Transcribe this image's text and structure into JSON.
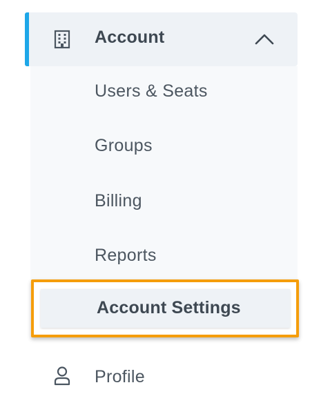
{
  "nav": {
    "account_section": {
      "label": "Account",
      "icon": "building-icon",
      "expanded": true,
      "accent_color": "#1ea7e8",
      "items": [
        {
          "label": "Users & Seats"
        },
        {
          "label": "Groups"
        },
        {
          "label": "Billing"
        },
        {
          "label": "Reports"
        },
        {
          "label": "Account Settings",
          "active": true
        }
      ]
    },
    "profile": {
      "label": "Profile",
      "icon": "user-icon"
    },
    "highlight_color": "#f59d0b"
  }
}
